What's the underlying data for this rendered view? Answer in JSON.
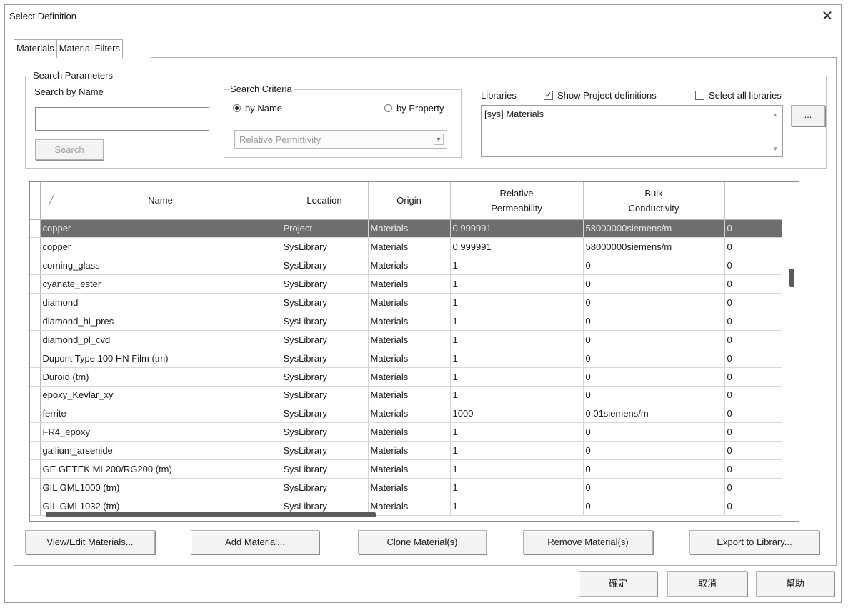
{
  "dialog": {
    "title": "Select Definition",
    "close_glyph": "✕"
  },
  "tabs": [
    {
      "label": "Materials"
    },
    {
      "label": "Material Filters"
    }
  ],
  "search_params": {
    "legend": "Search Parameters",
    "search_by_name_label": "Search by Name",
    "name_value": "",
    "search_button": "Search",
    "criteria": {
      "legend": "Search Criteria",
      "by_name": "by Name",
      "by_property": "by Property",
      "selected": "by Name",
      "property_combo": "Relative Permittivity"
    },
    "libraries": {
      "label": "Libraries",
      "show_project": "Show Project definitions",
      "show_project_checked": true,
      "select_all": "Select all libraries",
      "select_all_checked": false,
      "list_item": "[sys] Materials",
      "browse_button": "..."
    }
  },
  "grid": {
    "sort_glyph": "╱",
    "columns": [
      "Name",
      "Location",
      "Origin",
      "Relative Permeability",
      "Bulk Conductivity",
      ""
    ],
    "column_lines": [
      [
        "Name"
      ],
      [
        "Location"
      ],
      [
        "Origin"
      ],
      [
        "Relative",
        "Permeability"
      ],
      [
        "Bulk",
        "Conductivity"
      ],
      [
        ""
      ]
    ],
    "rows": [
      [
        "copper",
        "Project",
        "Materials",
        "0.999991",
        "58000000siemens/m",
        "0"
      ],
      [
        "copper",
        "SysLibrary",
        "Materials",
        "0.999991",
        "58000000siemens/m",
        "0"
      ],
      [
        "corning_glass",
        "SysLibrary",
        "Materials",
        "1",
        "0",
        "0"
      ],
      [
        "cyanate_ester",
        "SysLibrary",
        "Materials",
        "1",
        "0",
        "0"
      ],
      [
        "diamond",
        "SysLibrary",
        "Materials",
        "1",
        "0",
        "0"
      ],
      [
        "diamond_hi_pres",
        "SysLibrary",
        "Materials",
        "1",
        "0",
        "0"
      ],
      [
        "diamond_pl_cvd",
        "SysLibrary",
        "Materials",
        "1",
        "0",
        "0"
      ],
      [
        "Dupont Type 100 HN Film (tm)",
        "SysLibrary",
        "Materials",
        "1",
        "0",
        "0"
      ],
      [
        "Duroid (tm)",
        "SysLibrary",
        "Materials",
        "1",
        "0",
        "0"
      ],
      [
        "epoxy_Kevlar_xy",
        "SysLibrary",
        "Materials",
        "1",
        "0",
        "0"
      ],
      [
        "ferrite",
        "SysLibrary",
        "Materials",
        "1000",
        "0.01siemens/m",
        "0"
      ],
      [
        "FR4_epoxy",
        "SysLibrary",
        "Materials",
        "1",
        "0",
        "0"
      ],
      [
        "gallium_arsenide",
        "SysLibrary",
        "Materials",
        "1",
        "0",
        "0"
      ],
      [
        "GE GETEK ML200/RG200 (tm)",
        "SysLibrary",
        "Materials",
        "1",
        "0",
        "0"
      ],
      [
        "GIL GML1000 (tm)",
        "SysLibrary",
        "Materials",
        "1",
        "0",
        "0"
      ],
      [
        "GIL GML1032 (tm)",
        "SysLibrary",
        "Materials",
        "1",
        "0",
        "0"
      ]
    ],
    "selected_row": 0
  },
  "actions": {
    "view_edit": "View/Edit Materials...",
    "add": "Add Material...",
    "clone": "Clone Material(s)",
    "remove": "Remove Material(s)",
    "export": "Export to Library..."
  },
  "footer": {
    "ok": "確定",
    "cancel": "取消",
    "help": "幫助"
  }
}
